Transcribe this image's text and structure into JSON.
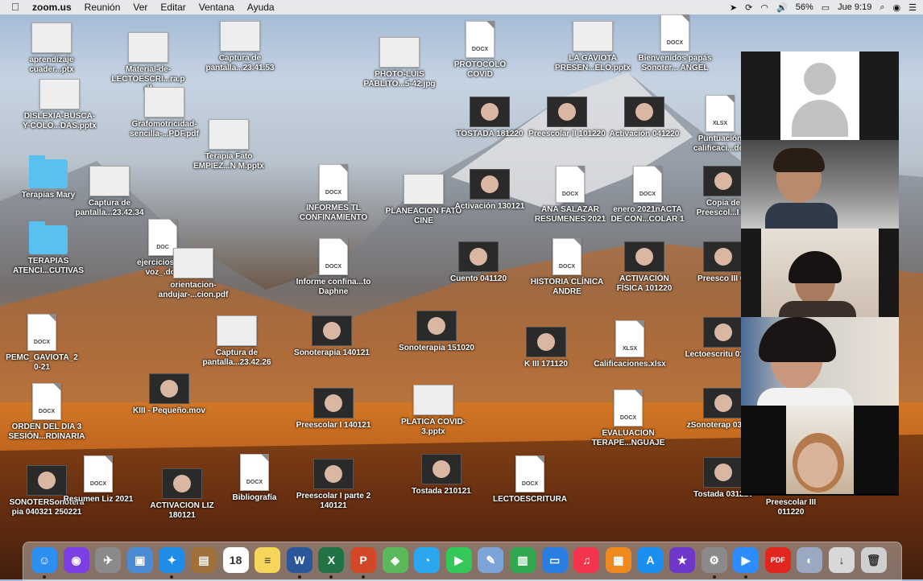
{
  "menubar": {
    "app_name": "zoom.us",
    "menus": [
      "Reunión",
      "Ver",
      "Editar",
      "Ventana",
      "Ayuda"
    ],
    "battery": "56%",
    "clock": "Jue 9:19"
  },
  "desktop_icons": [
    {
      "label": "aprendizaje cuader...ptx",
      "kind": "shot"
    },
    {
      "label": "Material-de-LECTOESCRI...ra.pdf",
      "kind": "shot"
    },
    {
      "label": "Captura de pantalla...23.41.53",
      "kind": "shot"
    },
    {
      "label": "PHOTO-LUIS PABLITO...5-42.jpg",
      "kind": "shot"
    },
    {
      "label": "PROTOCOLO COVID",
      "kind": "doc",
      "badge": "DOCX"
    },
    {
      "label": "LA GAVIOTA PRESEN...ELO.pptx",
      "kind": "shot"
    },
    {
      "label": "Bienvenidos papás Sonoter... ANGEL",
      "kind": "doc",
      "badge": "DOCX"
    },
    {
      "label": "DISLEXIA-BUSCA-Y-COLO...DAS.pptx",
      "kind": "shot"
    },
    {
      "label": "Grafomotricidad-sencilla-...PDF.pdf",
      "kind": "shot"
    },
    {
      "label": "Terapia Fato EMPIEZ...N M.pptx",
      "kind": "shot"
    },
    {
      "label": "TOSTADA 181220",
      "kind": "vid"
    },
    {
      "label": "Preescolar II 101220",
      "kind": "vid"
    },
    {
      "label": "Activación 041220",
      "kind": "vid"
    },
    {
      "label": "Puntuación calificaci...do)",
      "kind": "doc",
      "badge": "XLSX"
    },
    {
      "label": "Terapias Mary",
      "kind": "folder"
    },
    {
      "label": "Captura de pantalla...23.42.34",
      "kind": "shot"
    },
    {
      "label": "INFORMES TL CONFINAMIENTO",
      "kind": "doc",
      "badge": "DOCX"
    },
    {
      "label": "PLANEACION FATO CINE",
      "kind": "shot"
    },
    {
      "label": "Activación 130121",
      "kind": "vid"
    },
    {
      "label": "ANA SALAZAR RESUMENES 2021",
      "kind": "doc",
      "badge": "DOCX"
    },
    {
      "label": "enero 2021nACTA DE CON...COLAR 1",
      "kind": "doc",
      "badge": "DOCX"
    },
    {
      "label": "Copia de Preescol...I 01",
      "kind": "vid"
    },
    {
      "label": "TERAPIAS ATENCI...CUTIVAS",
      "kind": "folder"
    },
    {
      "label": "ejercicios ri... voz_.doc",
      "kind": "doc",
      "badge": "DOC"
    },
    {
      "label": "orientacion-andujar-...cion.pdf",
      "kind": "shot"
    },
    {
      "label": "Informe confina...to Daphne",
      "kind": "doc",
      "badge": "DOCX"
    },
    {
      "label": "Cuento 041120",
      "kind": "vid"
    },
    {
      "label": "HISTORIA CLÍNICA ANDRE",
      "kind": "doc",
      "badge": "DOCX"
    },
    {
      "label": "ACTIVACIÓN FÍSICA 101220",
      "kind": "vid"
    },
    {
      "label": "Preesco III 01",
      "kind": "vid"
    },
    {
      "label": "PEMC_GAVIOTA_2 0-21",
      "kind": "doc",
      "badge": "DOCX"
    },
    {
      "label": "Captura de pantalla...23.42.26",
      "kind": "shot"
    },
    {
      "label": "Sonoterapia 140121",
      "kind": "vid"
    },
    {
      "label": "Sonoterapia 151020",
      "kind": "vid"
    },
    {
      "label": "K III 171120",
      "kind": "vid"
    },
    {
      "label": "Calificaciones.xlsx",
      "kind": "doc",
      "badge": "XLSX"
    },
    {
      "label": "Lectoescritu 011220",
      "kind": "vid"
    },
    {
      "label": "KIII - Pequeño.mov",
      "kind": "vid"
    },
    {
      "label": "ORDEN DEL DIA 3 SESIÓN...RDINARIA",
      "kind": "doc",
      "badge": "DOCX"
    },
    {
      "label": "Preescolar I 140121",
      "kind": "vid"
    },
    {
      "label": "PLATICA COVID-3.pptx",
      "kind": "shot"
    },
    {
      "label": "EVALUACION TERAPE...NGUAJE",
      "kind": "doc",
      "badge": "DOCX"
    },
    {
      "label": "zSonoterap 031220",
      "kind": "vid"
    },
    {
      "label": "SONOTERSonoterapia 040321 250221",
      "kind": "vid"
    },
    {
      "label": "Resumen Liz 2021",
      "kind": "doc",
      "badge": "DOCX"
    },
    {
      "label": "ACTIVACION LIZ 180121",
      "kind": "vid"
    },
    {
      "label": "Bibliografía",
      "kind": "doc",
      "badge": "DOCX"
    },
    {
      "label": "Preescolar I parte 2 140121",
      "kind": "vid"
    },
    {
      "label": "Tostada 210121",
      "kind": "vid"
    },
    {
      "label": "LECTOESCRITURA",
      "kind": "doc",
      "badge": "DOCX"
    },
    {
      "label": "Tostada 031220",
      "kind": "vid"
    },
    {
      "label": "Preescolar III 011220",
      "kind": "vid"
    }
  ],
  "zoom_gallery": {
    "tiles": [
      "participant-no-video",
      "participant-child-1",
      "participant-woman-1",
      "participant-woman-2",
      "participant-child-2"
    ]
  },
  "dock": {
    "apps": [
      {
        "name": "finder-icon",
        "glyph": "☺",
        "color": "#2d8ff0"
      },
      {
        "name": "siri-icon",
        "glyph": "◉",
        "color": "#7b3fe4"
      },
      {
        "name": "launchpad-icon",
        "glyph": "✈",
        "color": "#8a8a8a"
      },
      {
        "name": "preview-icon",
        "glyph": "▣",
        "color": "#4b8bd6"
      },
      {
        "name": "safari-icon",
        "glyph": "✦",
        "color": "#1f8ce8"
      },
      {
        "name": "notes-brown-icon",
        "glyph": "▤",
        "color": "#a0703a"
      },
      {
        "name": "calendar-icon",
        "glyph": "18",
        "color": "#ffffff"
      },
      {
        "name": "notes-icon",
        "glyph": "≡",
        "color": "#f5d65a"
      },
      {
        "name": "word-icon",
        "glyph": "W",
        "color": "#2b579a"
      },
      {
        "name": "excel-icon",
        "glyph": "X",
        "color": "#217346"
      },
      {
        "name": "powerpoint-icon",
        "glyph": "P",
        "color": "#d24726"
      },
      {
        "name": "maps-icon",
        "glyph": "◈",
        "color": "#5cb85c"
      },
      {
        "name": "messages-icon",
        "glyph": "◔",
        "color": "#2aa7f0"
      },
      {
        "name": "facetime-icon",
        "glyph": "▶",
        "color": "#34c759"
      },
      {
        "name": "stickies-icon",
        "glyph": "✎",
        "color": "#7da4d8"
      },
      {
        "name": "numbers-icon",
        "glyph": "▥",
        "color": "#2fa84f"
      },
      {
        "name": "keynote-icon",
        "glyph": "▭",
        "color": "#2a7de1"
      },
      {
        "name": "music-icon",
        "glyph": "♫",
        "color": "#f2354d"
      },
      {
        "name": "books-icon",
        "glyph": "▦",
        "color": "#f0891d"
      },
      {
        "name": "app-store-icon",
        "glyph": "A",
        "color": "#1b8ef2"
      },
      {
        "name": "imovie-icon",
        "glyph": "★",
        "color": "#6e37c9"
      },
      {
        "name": "system-preferences-icon",
        "glyph": "⚙",
        "color": "#8a8a8a"
      },
      {
        "name": "zoom-icon",
        "glyph": "▶",
        "color": "#2d8cff"
      },
      {
        "name": "pdf-icon",
        "glyph": "PDF",
        "color": "#e0261e"
      },
      {
        "name": "photo-browser-icon",
        "glyph": "◐",
        "color": "#9aa9c2"
      },
      {
        "name": "downloads-icon",
        "glyph": "↓",
        "color": "#d8d8d8"
      },
      {
        "name": "trash-icon",
        "glyph": "🗑",
        "color": "#cfcfcf"
      }
    ]
  }
}
